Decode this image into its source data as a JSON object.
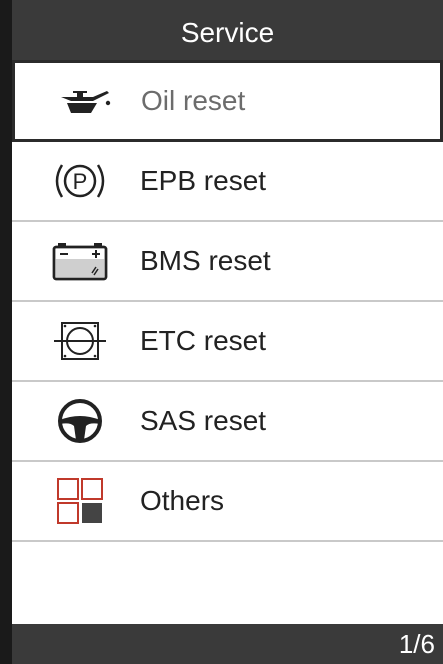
{
  "header": {
    "title": "Service"
  },
  "menu": {
    "items": [
      {
        "label": "Oil reset",
        "icon": "oil-can-icon",
        "selected": true
      },
      {
        "label": "EPB reset",
        "icon": "parking-brake-icon",
        "selected": false
      },
      {
        "label": "BMS reset",
        "icon": "battery-icon",
        "selected": false
      },
      {
        "label": "ETC reset",
        "icon": "throttle-icon",
        "selected": false
      },
      {
        "label": "SAS reset",
        "icon": "steering-wheel-icon",
        "selected": false
      },
      {
        "label": "Others",
        "icon": "grid-icon",
        "selected": false
      }
    ]
  },
  "footer": {
    "page": "1/6"
  },
  "colors": {
    "bar": "#3a3a3a",
    "accent_red": "#c0392b",
    "divider": "#c9c9c9"
  }
}
